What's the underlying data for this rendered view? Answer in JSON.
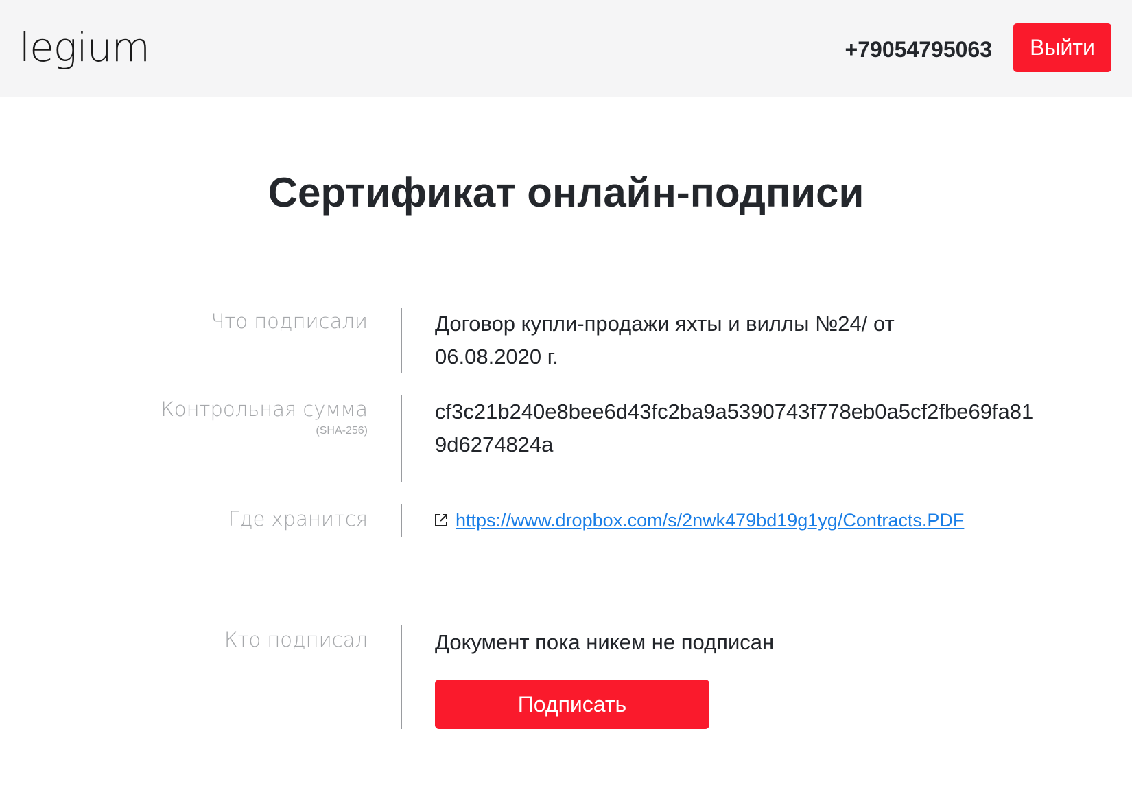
{
  "header": {
    "logo": "legium",
    "phone": "+79054795063",
    "logout_label": "Выйти"
  },
  "page": {
    "title": "Сертификат онлайн-подписи"
  },
  "rows": {
    "what": {
      "label": "Что подписали",
      "value_line1": "Договор купли-продажи яхты и виллы №24/ от",
      "value_line2": "06.08.2020 г."
    },
    "checksum": {
      "label": "Контрольная сумма",
      "sublabel": "(SHA-256)",
      "value": "cf3c21b240e8bee6d43fc2ba9a5390743f778eb0a5cf2fbe69fa819d6274824a"
    },
    "where": {
      "label": "Где хранится",
      "link": "https://www.dropbox.com/s/2nwk479bd19g1yg/Contracts.PDF",
      "icon": "external-link-icon"
    },
    "who": {
      "label": "Кто подписал",
      "value": "Документ пока никем не подписан",
      "sign_label": "Подписать"
    }
  },
  "colors": {
    "accent": "#fa1a2c",
    "link": "#1a7ee6",
    "header_bg": "#f5f5f6",
    "label": "#a6a8ab"
  }
}
